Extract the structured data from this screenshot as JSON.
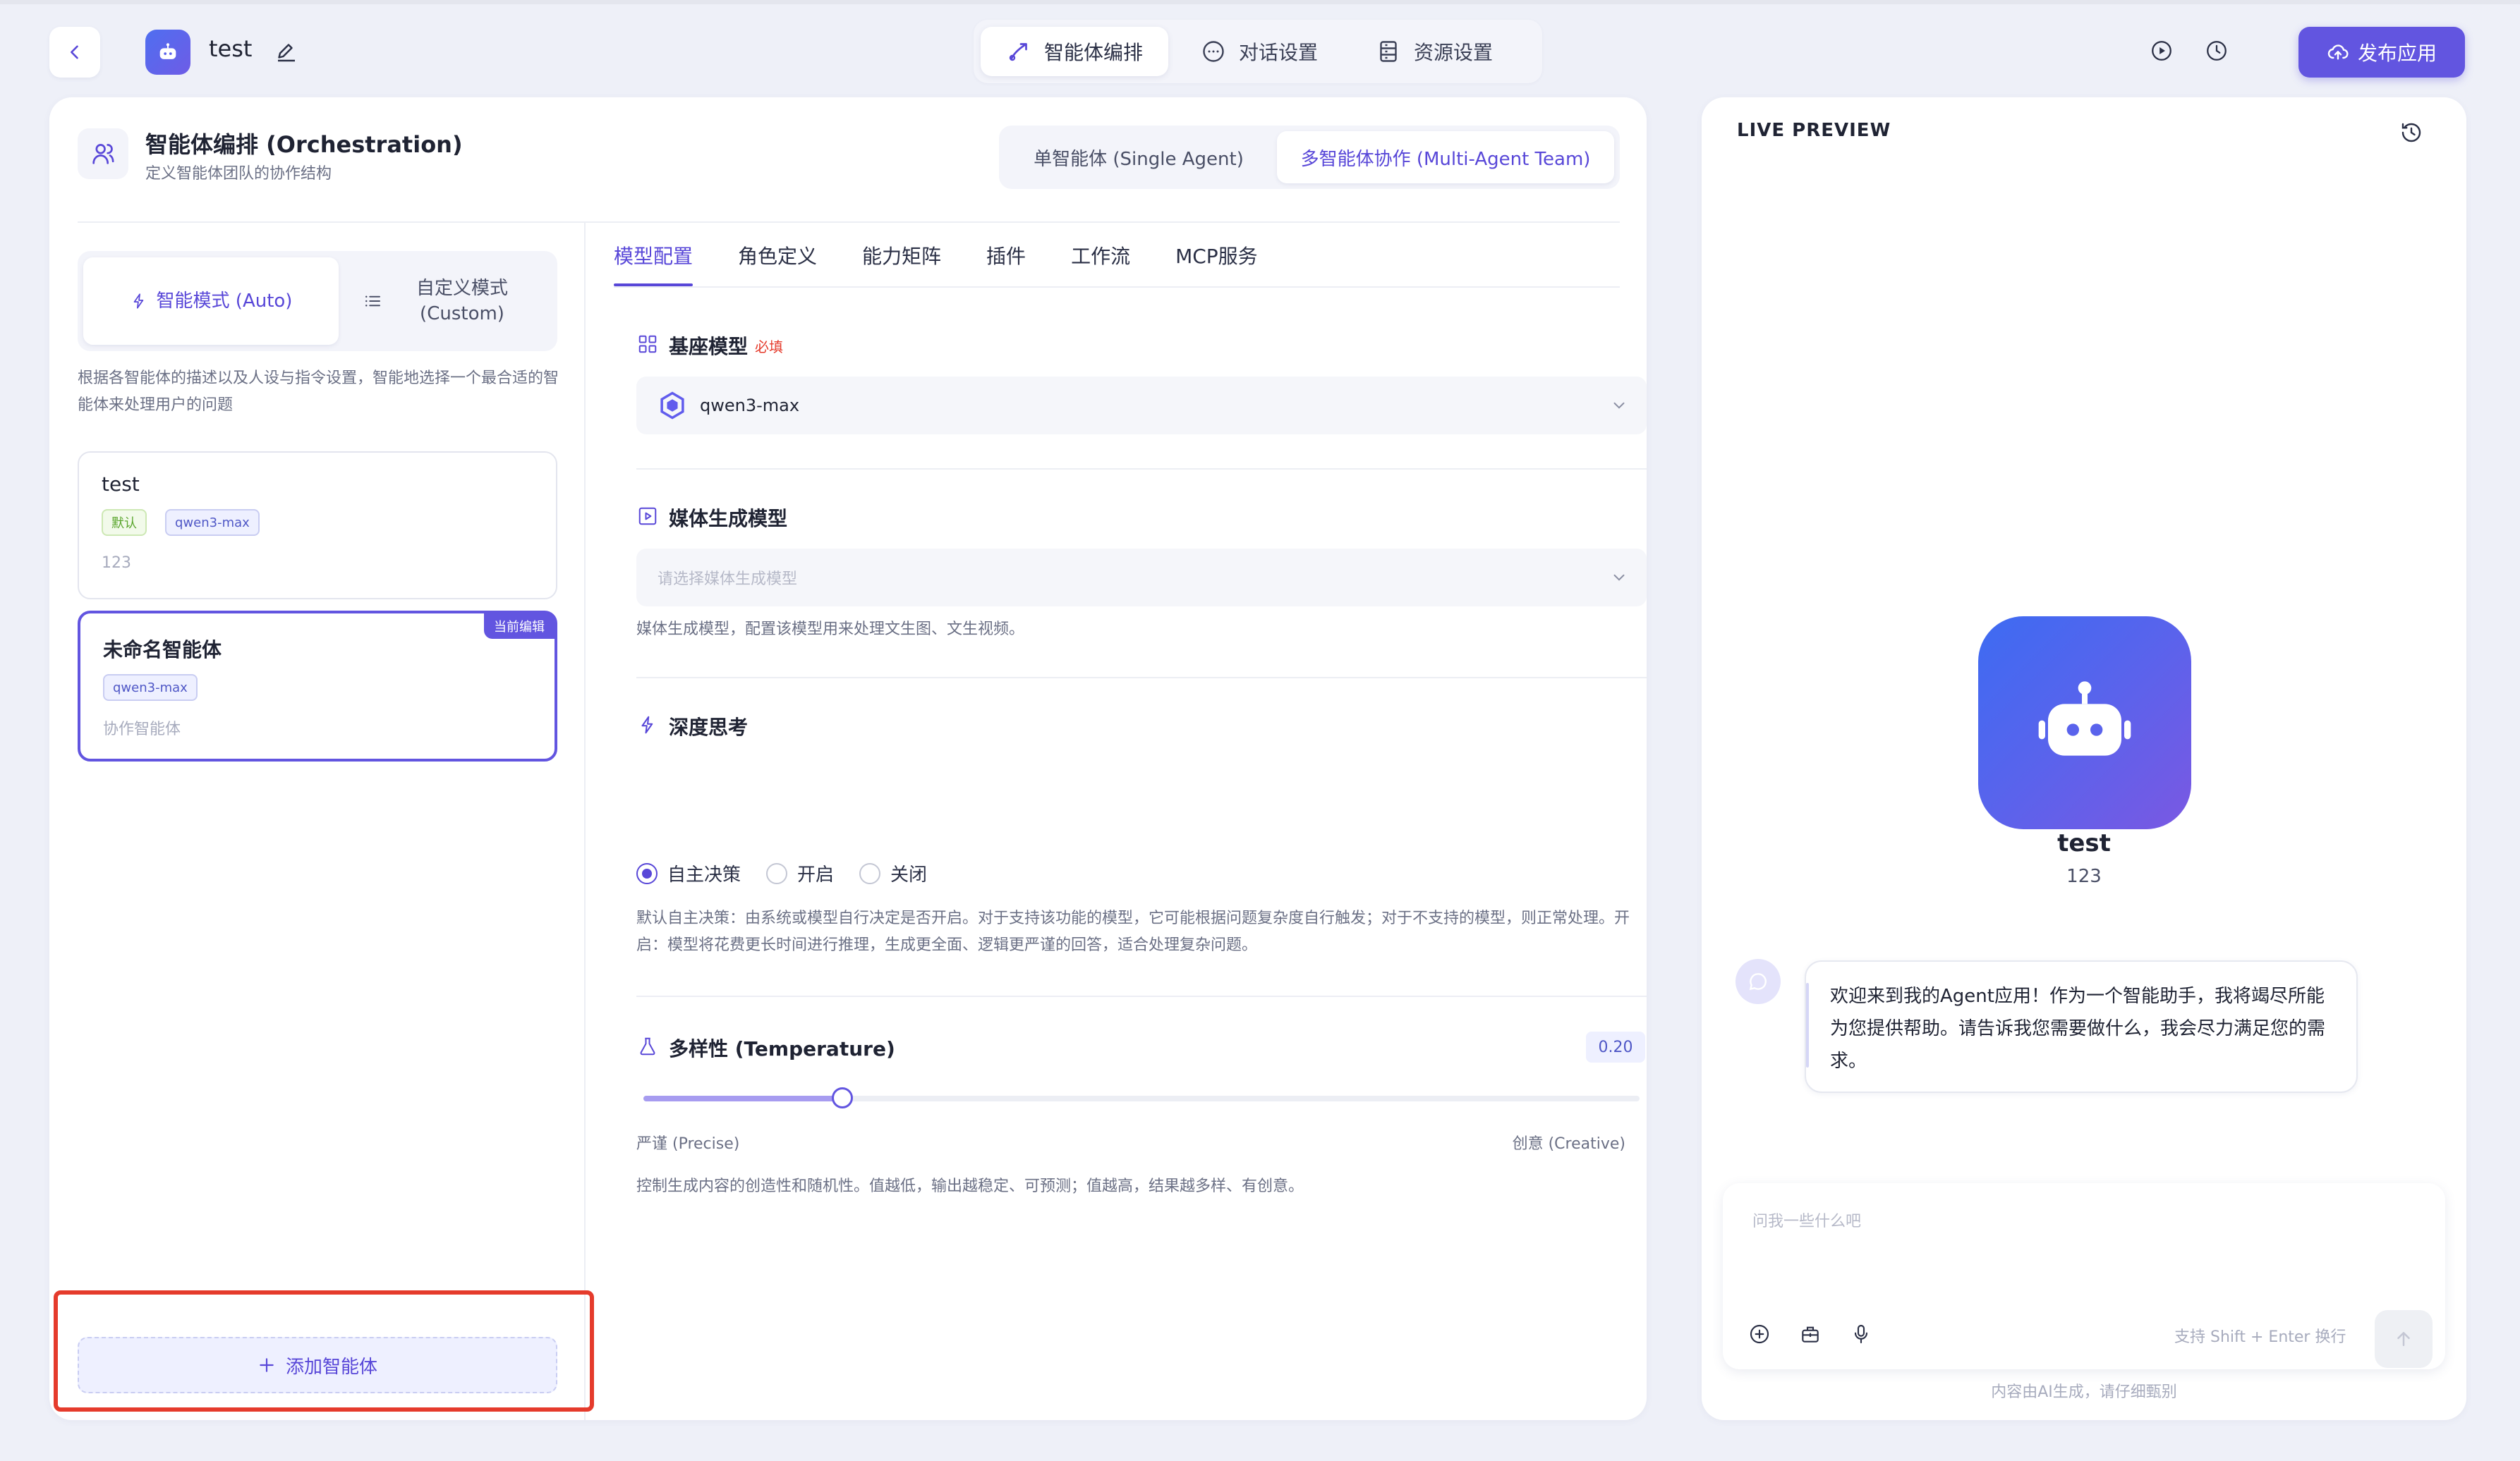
{
  "topbar": {
    "app_name": "test",
    "tabs": [
      {
        "label": "智能体编排",
        "icon": "orchestration-icon",
        "active": true
      },
      {
        "label": "对话设置",
        "icon": "chat-settings-icon",
        "active": false
      },
      {
        "label": "资源设置",
        "icon": "resource-settings-icon",
        "active": false
      }
    ],
    "publish_label": "发布应用"
  },
  "orchestration": {
    "title": "智能体编排 (Orchestration)",
    "subtitle": "定义智能体团队的协作结构",
    "modes": [
      {
        "label": "单智能体 (Single Agent)",
        "active": false
      },
      {
        "label": "多智能体协作 (Multi-Agent Team)",
        "active": true
      }
    ]
  },
  "strategy": {
    "auto_label": "智能模式 (Auto)",
    "custom_label_line1": "自定义模式",
    "custom_label_line2": "(Custom)",
    "description": "根据各智能体的描述以及人设与指令设置，智能地选择一个最合适的智能体来处理用户的问题"
  },
  "agents": [
    {
      "name": "test",
      "default_tag": "默认",
      "model": "qwen3-max",
      "description": "123",
      "current": false
    },
    {
      "name": "未命名智能体",
      "model": "qwen3-max",
      "description": "协作智能体",
      "current": true,
      "badge": "当前编辑"
    }
  ],
  "add_agent_label": "添加智能体",
  "sub_tabs": [
    "模型配置",
    "角色定义",
    "能力矩阵",
    "插件",
    "工作流",
    "MCP服务"
  ],
  "base_model": {
    "label": "基座模型",
    "required": "必填",
    "value": "qwen3-max"
  },
  "media_model": {
    "label": "媒体生成模型",
    "placeholder": "请选择媒体生成模型",
    "description": "媒体生成模型，配置该模型用来处理文生图、文生视频。"
  },
  "deep_thinking": {
    "label": "深度思考",
    "options": [
      {
        "label": "自主决策",
        "checked": true
      },
      {
        "label": "开启",
        "checked": false
      },
      {
        "label": "关闭",
        "checked": false
      }
    ],
    "description": "默认自主决策：由系统或模型自行决定是否开启。对于支持该功能的模型，它可能根据问题复杂度自行触发；对于不支持的模型，则正常处理。开启：模型将花费更长时间进行推理，生成更全面、逻辑更严谨的回答，适合处理复杂问题。"
  },
  "temperature": {
    "label": "多样性 (Temperature)",
    "value": "0.20",
    "fraction": 0.2,
    "min_label": "严谨 (Precise)",
    "max_label": "创意 (Creative)",
    "description": "控制生成内容的创造性和随机性。值越低，输出越稳定、可预测；值越高，结果越多样、有创意。"
  },
  "preview": {
    "title": "LIVE PREVIEW",
    "bot_name": "test",
    "bot_desc": "123",
    "welcome": "欢迎来到我的Agent应用！作为一个智能助手，我将竭尽所能为您提供帮助。请告诉我您需要做什么，我会尽力满足您的需求。",
    "input_placeholder": "问我一些什么吧",
    "hint": "支持 Shift + Enter 换行",
    "notice": "内容由AI生成，请仔细甄别"
  },
  "colors": {
    "accent": "#6255e0",
    "highlight": "#e53b2c"
  }
}
